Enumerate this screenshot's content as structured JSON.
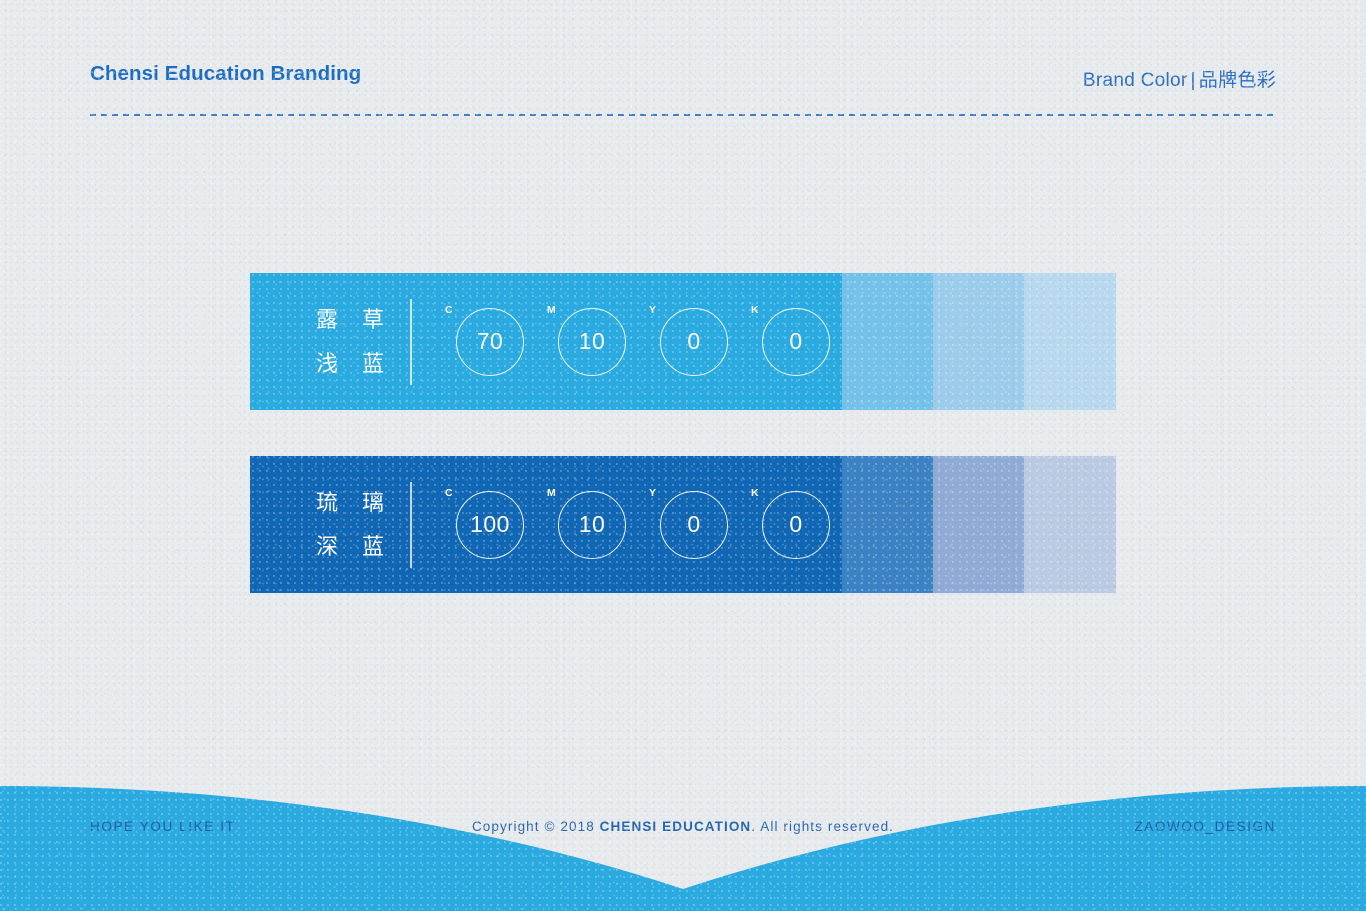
{
  "header": {
    "title": "Chensi Education Branding",
    "right_en": "Brand Color",
    "separator": "|",
    "right_cn": "品牌色彩"
  },
  "palette": [
    {
      "name_cn_line1_a": "露",
      "name_cn_line1_b": "草",
      "name_cn_line2_a": "浅",
      "name_cn_line2_b": "蓝",
      "base_color": "#29abe2",
      "channels": [
        {
          "letter": "C",
          "value": "70"
        },
        {
          "letter": "M",
          "value": "10"
        },
        {
          "letter": "Y",
          "value": "0"
        },
        {
          "letter": "K",
          "value": "0"
        }
      ],
      "tints": [
        "#74c2ea",
        "#9ecdec",
        "#b9d9ee"
      ]
    },
    {
      "name_cn_line1_a": "琉",
      "name_cn_line1_b": "璃",
      "name_cn_line2_a": "深",
      "name_cn_line2_b": "蓝",
      "base_color": "#0e66b5",
      "channels": [
        {
          "letter": "C",
          "value": "100"
        },
        {
          "letter": "M",
          "value": "10"
        },
        {
          "letter": "Y",
          "value": "0"
        },
        {
          "letter": "K",
          "value": "0"
        }
      ],
      "tints": [
        "#3a82c4",
        "#8fabd6",
        "#bccbe3"
      ]
    }
  ],
  "footer": {
    "left": "HOPE YOU LIKE IT",
    "copyright_pre": "Copyright © 2018 ",
    "copyright_brand": "CHENSI EDUCATION",
    "copyright_post": ". All rights reserved.",
    "right": "ZAOWOO_DESIGN",
    "band_color": "#29abe2"
  }
}
